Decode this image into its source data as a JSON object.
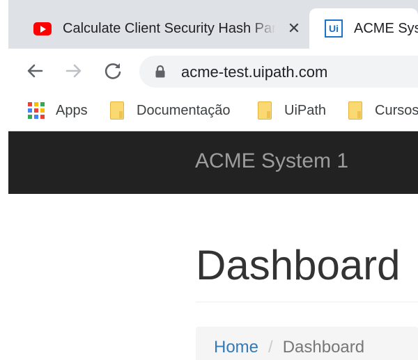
{
  "browser": {
    "tabs": [
      {
        "title": "Calculate Client Security Hash Par",
        "icon": "youtube-icon",
        "active": false
      },
      {
        "title": "ACME Syst",
        "icon": "uipath-icon",
        "icon_text": "Ui",
        "active": true
      }
    ],
    "tab_close_glyph": "✕",
    "url": "acme-test.uipath.com",
    "bookmarks": [
      {
        "label": "Apps",
        "icon": "apps-grid-icon"
      },
      {
        "label": "Documentação",
        "icon": "folder-icon"
      },
      {
        "label": "UiPath",
        "icon": "folder-icon"
      },
      {
        "label": "Cursos",
        "icon": "folder-icon"
      }
    ]
  },
  "app": {
    "brand": "ACME System 1",
    "header_color": "#222222"
  },
  "main": {
    "title": "Dashboard",
    "breadcrumb": [
      {
        "label": "Home",
        "link": true
      },
      {
        "label": "/",
        "separator": true
      },
      {
        "label": "Dashboard",
        "link": false
      }
    ]
  },
  "colors": {
    "tabstrip": "#dee1e6",
    "link": "#337ab7",
    "youtube_red": "#ff0000",
    "uipath_blue": "#1a73c9"
  }
}
